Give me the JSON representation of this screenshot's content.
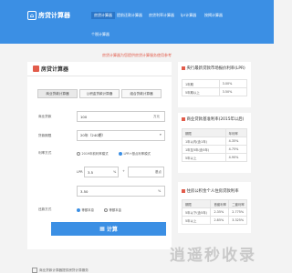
{
  "site": {
    "logo_text": "房贷计算器"
  },
  "nav": {
    "items": [
      "房贷计算器",
      "提前还款计算器",
      "房贷利率计算器",
      "lpr计算器",
      "按揭计算器",
      "个税计算器"
    ],
    "active_index": 0
  },
  "notice": "房贷计算器为您提供房贷计算服务使用参考",
  "calc": {
    "title": "房贷计算器",
    "tabs": [
      "商业贷款计算器",
      "公积金贷款计算器",
      "组合贷款计算器"
    ],
    "active_tab": 0,
    "loan_amount_label": "商业贷款",
    "loan_amount_value": "100",
    "loan_amount_unit": "万元",
    "years_label": "贷款期限",
    "years_value": "20年（240期）",
    "rate_label": "利率方式",
    "rate_options": [
      "2019年前利率模式",
      "LPR+基点利率模式"
    ],
    "rate_selected": 1,
    "lpr_label": "LPR",
    "lpr_value": "3.5",
    "percent": "%",
    "plus": "+",
    "bp_unit": "基点",
    "rate_result_value": "3.50",
    "repay_label": "还款方式",
    "repay_options": [
      "等额本息",
      "等额本金"
    ],
    "repay_selected": 0,
    "calc_button": "计算"
  },
  "lpr_box": {
    "title": "央行最新贷款市场报价利率(LPR)",
    "rows": [
      [
        "1年期",
        "3.00%"
      ],
      [
        "5年期以上",
        "3.50%"
      ]
    ]
  },
  "bank_box": {
    "title": "商业贷款基准利率(2015年以后)",
    "rows": [
      [
        "期限",
        "年利率"
      ],
      [
        "1年以内(含1年)",
        "4.35%"
      ],
      [
        "1年至5年(含5年)",
        "4.75%"
      ],
      [
        "5年以上",
        "4.90%"
      ]
    ]
  },
  "fund_box": {
    "title": "住房公积金个人住房贷款利率",
    "rows": [
      [
        "期限",
        "首套利率",
        "二套利率"
      ],
      [
        "5年以下(含5年)",
        "2.35%",
        "2.775%"
      ],
      [
        "5年以上",
        "2.85%",
        "3.325%"
      ]
    ]
  },
  "footer": {
    "text": "商业贷款计算器提供房贷计算服务"
  },
  "watermark": "逍遥秒收录"
}
